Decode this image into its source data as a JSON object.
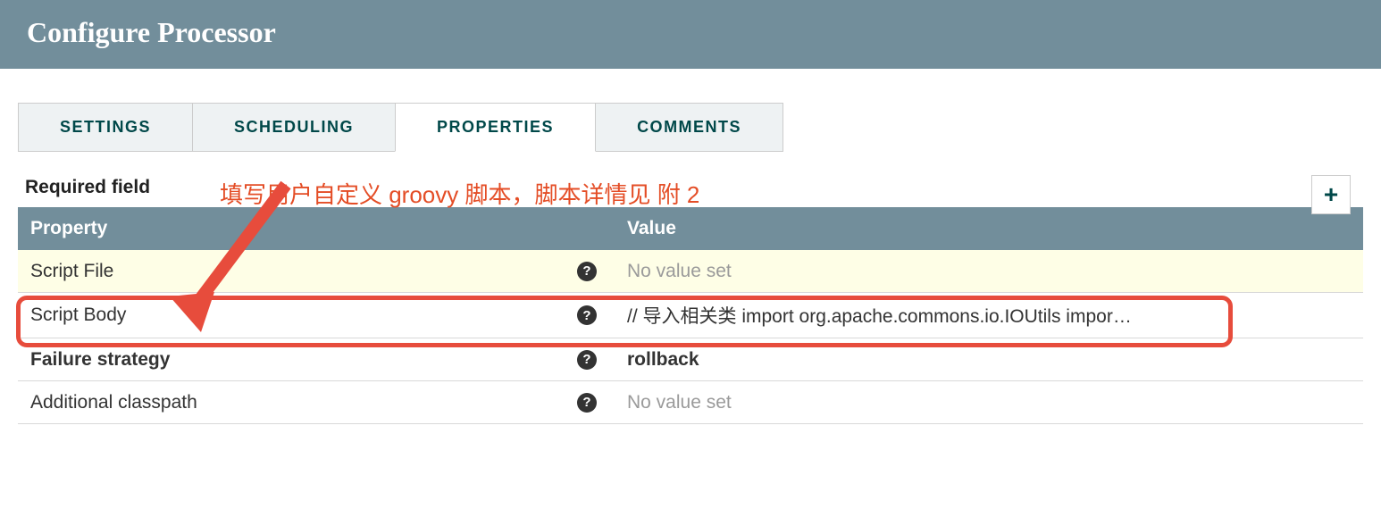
{
  "header": {
    "title": "Configure Processor"
  },
  "tabs": {
    "items": [
      {
        "label": "SETTINGS"
      },
      {
        "label": "SCHEDULING"
      },
      {
        "label": "PROPERTIES"
      },
      {
        "label": "COMMENTS"
      }
    ],
    "active_index": 2
  },
  "required_field_label": "Required field",
  "annotation_text": "填写用户自定义 groovy 脚本，脚本详情见 附 2",
  "add_button_label": "+",
  "table": {
    "columns": {
      "property": "Property",
      "value": "Value"
    },
    "rows": [
      {
        "name": "Script File",
        "value": "No value set",
        "placeholder": true,
        "bold_name": false,
        "bold_value": false,
        "highlight": true
      },
      {
        "name": "Script Body",
        "value": "// 导入相关类 import org.apache.commons.io.IOUtils impor…",
        "placeholder": false,
        "bold_name": false,
        "bold_value": false,
        "highlight": false
      },
      {
        "name": "Failure strategy",
        "value": "rollback",
        "placeholder": false,
        "bold_name": true,
        "bold_value": true,
        "highlight": false
      },
      {
        "name": "Additional classpath",
        "value": "No value set",
        "placeholder": true,
        "bold_name": false,
        "bold_value": false,
        "highlight": false
      }
    ]
  },
  "colors": {
    "header_bg": "#728e9b",
    "accent": "#004849",
    "annotation": "#e74c3c"
  }
}
